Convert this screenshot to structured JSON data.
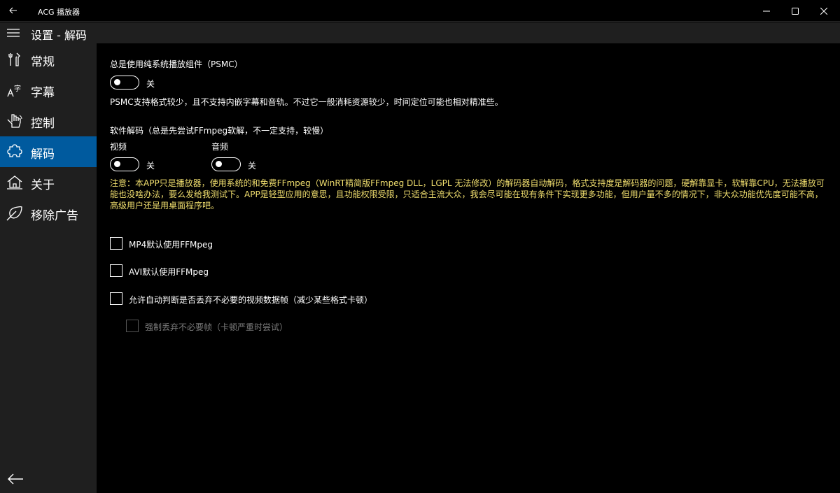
{
  "window": {
    "title": "ACG 播放器"
  },
  "header": {
    "title": "设置 - 解码"
  },
  "sidebar": {
    "items": [
      {
        "label": "常规",
        "icon": "tools-icon"
      },
      {
        "label": "字幕",
        "icon": "text-icon"
      },
      {
        "label": "控制",
        "icon": "hand-icon"
      },
      {
        "label": "解码",
        "icon": "puzzle-icon",
        "selected": true
      },
      {
        "label": "关于",
        "icon": "home-icon"
      },
      {
        "label": "移除广告",
        "icon": "leaf-icon"
      }
    ]
  },
  "content": {
    "psmc": {
      "label": "总是使用纯系统播放组件（PSMC）",
      "state": "关",
      "description": "PSMC支持格式较少，且不支持内嵌字幕和音轨。不过它一般消耗资源较少，时间定位可能也相对精准些。"
    },
    "software_decode": {
      "label": "软件解码（总是先尝试FFmpeg软解，不一定支持，较慢）",
      "video_label": "视频",
      "video_state": "关",
      "audio_label": "音频",
      "audio_state": "关",
      "note": "注意：本APP只是播放器，使用系统的和免费FFmpeg（WinRT精简版FFmpeg DLL，LGPL 无法修改）的解码器自动解码，格式支持度是解码器的问题，硬解靠显卡，软解靠CPU，无法播放可能也没啥办法，要么发给我测试下。APP是轻型应用的意思，且功能权限受限，只适合主流大众，我会尽可能在现有条件下实现更多功能，但用户量不多的情况下，非大众功能优先度可能不高，高级用户还是用桌面程序吧。"
    },
    "checkboxes": [
      {
        "label": "MP4默认使用FFMpeg"
      },
      {
        "label": "AVI默认使用FFMpeg"
      },
      {
        "label": "允许自动判断是否丢弃不必要的视频数据帧（减少某些格式卡顿）"
      },
      {
        "label": "强制丢弃不必要帧（卡顿严重时尝试）",
        "disabled": true
      }
    ]
  },
  "colors": {
    "accent": "#005a9e",
    "note": "#f0de6e",
    "sidebar_bg": "#1f1f1f"
  }
}
